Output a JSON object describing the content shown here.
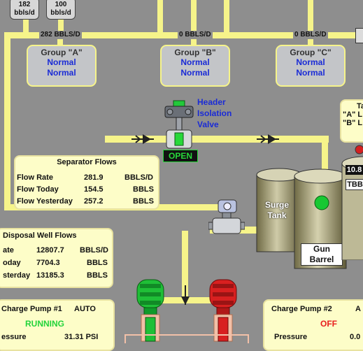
{
  "top_rates": [
    {
      "value": "182",
      "unit": "bbls/d"
    },
    {
      "value": "100",
      "unit": "bbls/d"
    }
  ],
  "header_flows": {
    "a": "282 BBLS/D",
    "b": "0 BBLS/D",
    "c": "0 BBLS/D"
  },
  "groups": [
    {
      "title": "Group \"A\"",
      "status1": "Normal",
      "status2": "Normal"
    },
    {
      "title": "Group \"B\"",
      "status1": "Normal",
      "status2": "Normal"
    },
    {
      "title": "Group \"C\"",
      "status1": "Normal",
      "status2": "Normal"
    }
  ],
  "valve": {
    "label_line1": "Header",
    "label_line2": "Isolation",
    "label_line3": "Valve",
    "state": "OPEN",
    "state_color": "#27d83a"
  },
  "separator_flows": {
    "title": "Separator Flows",
    "rows": [
      {
        "label": "Flow Rate",
        "value": "281.9",
        "unit": "BBLS/D"
      },
      {
        "label": "Flow Today",
        "value": "154.5",
        "unit": "BBLS"
      },
      {
        "label": "Flow Yesterday",
        "value": "257.2",
        "unit": "BBLS"
      }
    ]
  },
  "disposal_flows": {
    "title": "Disposal Well Flows",
    "rows": [
      {
        "label": "ate",
        "value": "12807.7",
        "unit": "BBLS/D"
      },
      {
        "label": "oday",
        "value": "7704.3",
        "unit": "BBLS"
      },
      {
        "label": "sterday",
        "value": "13185.3",
        "unit": "BBLS"
      }
    ]
  },
  "tanks": {
    "surge": {
      "line1": "Surge",
      "line2": "Tank"
    },
    "gun": {
      "line1": "Gun",
      "line2": "Barrel"
    },
    "right_level": "10.8",
    "right_unit": "TBB"
  },
  "right_panel": {
    "title": "Ta",
    "line1": "\"A\" L",
    "line2": "\"B\" L"
  },
  "pump1": {
    "title": "Charge Pump #1",
    "mode": "AUTO",
    "status": "RUNNING",
    "pressure_label": "essure",
    "pressure_value": "31.31 PSI",
    "status_color": "#22d43a"
  },
  "pump2": {
    "title": "Charge Pump #2",
    "mode": "A",
    "status": "OFF",
    "pressure_label": "Pressure",
    "pressure_value": "0.0",
    "status_color": "#e81c1c"
  },
  "colors": {
    "pipe": "#f6f48a",
    "background": "#8e8e8e",
    "status_text": "#1a2bd6"
  }
}
